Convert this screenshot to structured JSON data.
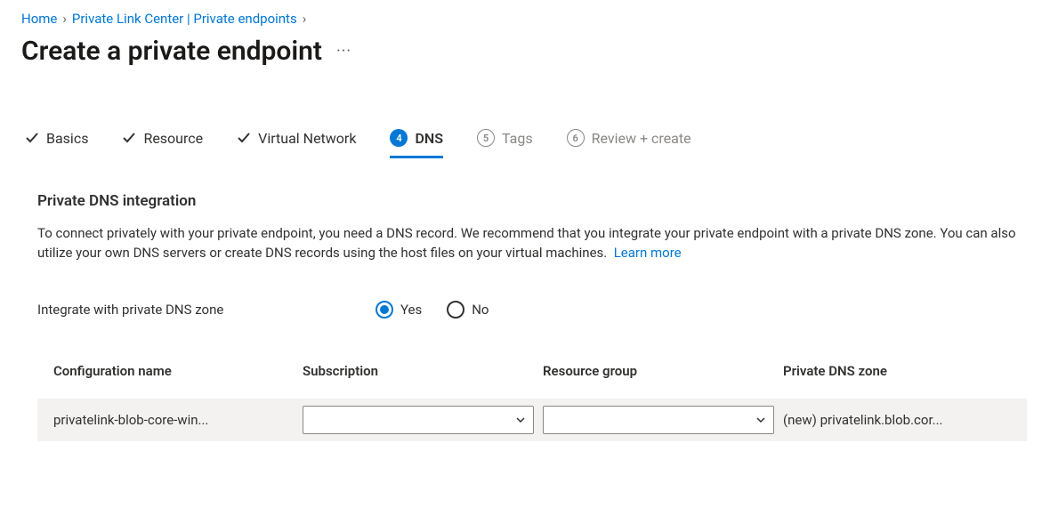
{
  "breadcrumb": {
    "home": "Home",
    "center": "Private Link Center | Private endpoints"
  },
  "title": "Create a private endpoint",
  "tabs": {
    "basics": "Basics",
    "resource": "Resource",
    "vnet": "Virtual Network",
    "dns_num": "4",
    "dns": "DNS",
    "tags_num": "5",
    "tags": "Tags",
    "review_num": "6",
    "review": "Review + create"
  },
  "section": {
    "heading": "Private DNS integration",
    "body": "To connect privately with your private endpoint, you need a DNS record. We recommend that you integrate your private endpoint with a private DNS zone. You can also utilize your own DNS servers or create DNS records using the host files on your virtual machines.",
    "learn_more": "Learn more"
  },
  "integrate": {
    "label": "Integrate with private DNS zone",
    "yes": "Yes",
    "no": "No",
    "selected": "yes"
  },
  "table": {
    "headers": {
      "config": "Configuration name",
      "sub": "Subscription",
      "rg": "Resource group",
      "zone": "Private DNS zone"
    },
    "row": {
      "config": "privatelink-blob-core-win...",
      "sub": "",
      "rg": "",
      "zone": "(new) privatelink.blob.cor..."
    }
  }
}
